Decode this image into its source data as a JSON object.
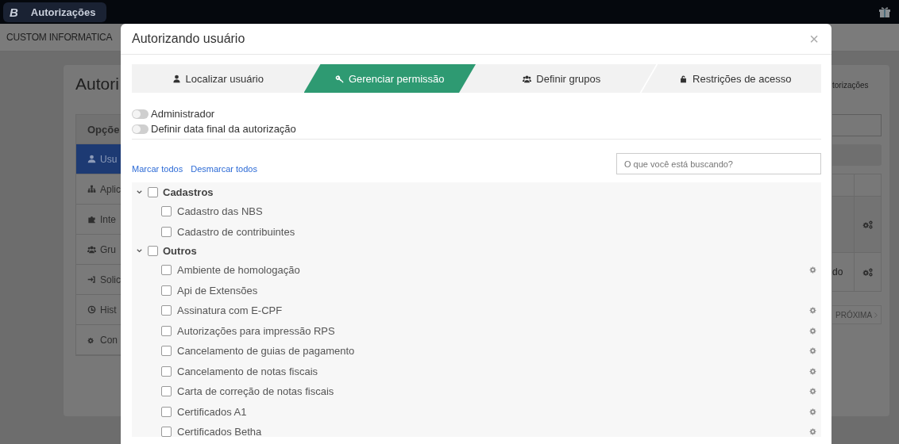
{
  "topbar": {
    "logo": "B",
    "app_title": "Autorizações"
  },
  "company_bar": {
    "name": "CUSTOM INFORMATICA"
  },
  "background_page": {
    "title": "Autori",
    "menu_header": "Opçõe",
    "menu_items": [
      {
        "label": "Usu",
        "selected": true
      },
      {
        "label": "Aplic",
        "selected": false
      },
      {
        "label": "Inte",
        "selected": false
      },
      {
        "label": "Gru",
        "selected": false
      },
      {
        "label": "Solic",
        "selected": false
      },
      {
        "label": "Hist",
        "selected": false
      },
      {
        "label": "Con",
        "selected": false
      }
    ],
    "right_link": "torizações",
    "table_rows": [
      {
        "cell": ""
      },
      {
        "cell": "do"
      }
    ],
    "next_button": "PRÓXIMA"
  },
  "modal": {
    "title": "Autorizando usuário",
    "close": "×",
    "tabs": [
      {
        "label": "Localizar usuário",
        "selected": false
      },
      {
        "label": "Gerenciar permissão",
        "selected": true
      },
      {
        "label": "Definir grupos",
        "selected": false
      },
      {
        "label": "Restrições de acesso",
        "selected": false
      }
    ],
    "toggles": [
      {
        "label": "Administrador",
        "on": false
      },
      {
        "label": "Definir data final da autorização",
        "on": false
      }
    ],
    "links": [
      "Marcar todos",
      "Desmarcar todos"
    ],
    "search": {
      "placeholder": "O que você está buscando?"
    },
    "tree": [
      {
        "label": "Cadastros",
        "expanded": true,
        "checked": false,
        "children": [
          {
            "label": "Cadastro das NBS",
            "checked": false,
            "configurable": false
          },
          {
            "label": "Cadastro de contribuintes",
            "checked": false,
            "configurable": false
          }
        ]
      },
      {
        "label": "Outros",
        "expanded": true,
        "checked": false,
        "children": [
          {
            "label": "Ambiente de homologação",
            "checked": false,
            "configurable": true
          },
          {
            "label": "Api de Extensões",
            "checked": false,
            "configurable": false
          },
          {
            "label": "Assinatura com E-CPF",
            "checked": false,
            "configurable": true
          },
          {
            "label": "Autorizações para impressão RPS",
            "checked": false,
            "configurable": true
          },
          {
            "label": "Cancelamento de guias de pagamento",
            "checked": false,
            "configurable": true
          },
          {
            "label": "Cancelamento de notas fiscais",
            "checked": false,
            "configurable": true
          },
          {
            "label": "Carta de correção de notas fiscais",
            "checked": false,
            "configurable": true
          },
          {
            "label": "Certificados A1",
            "checked": false,
            "configurable": true
          },
          {
            "label": "Certificados Betha",
            "checked": false,
            "configurable": true
          }
        ]
      }
    ]
  }
}
